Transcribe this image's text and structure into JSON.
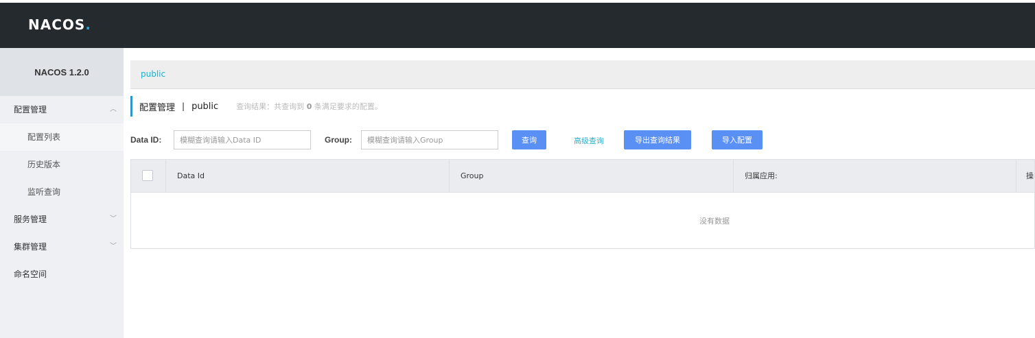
{
  "header": {
    "logo_text": "NACOS",
    "logo_dot": "."
  },
  "sidebar": {
    "title": "NACOS 1.2.0",
    "items": [
      {
        "label": "配置管理",
        "chevron": "^"
      },
      {
        "label": "配置列表"
      },
      {
        "label": "历史版本"
      },
      {
        "label": "监听查询"
      },
      {
        "label": "服务管理",
        "chevron": "v"
      },
      {
        "label": "集群管理",
        "chevron": "v"
      },
      {
        "label": "命名空间"
      }
    ]
  },
  "namespace_bar": {
    "current": "public"
  },
  "title_row": {
    "title": "配置管理",
    "separator": "|",
    "namespace": "public",
    "result_prefix": "查询结果：共查询到",
    "result_count": "0",
    "result_suffix": "条满足要求的配置。"
  },
  "filter": {
    "data_id_label": "Data ID:",
    "data_id_placeholder": "模糊查询请输入Data ID",
    "group_label": "Group:",
    "group_placeholder": "模糊查询请输入Group",
    "query_button": "查询",
    "advanced_query": "高级查询",
    "export_button": "导出查询结果",
    "import_button": "导入配置"
  },
  "table": {
    "columns": [
      "Data Id",
      "Group",
      "归属应用:",
      "操"
    ],
    "empty_text": "没有数据"
  },
  "colors": {
    "topbar": "#252a2f",
    "accent": "#5a8ff3",
    "link": "#1ab0d1"
  }
}
